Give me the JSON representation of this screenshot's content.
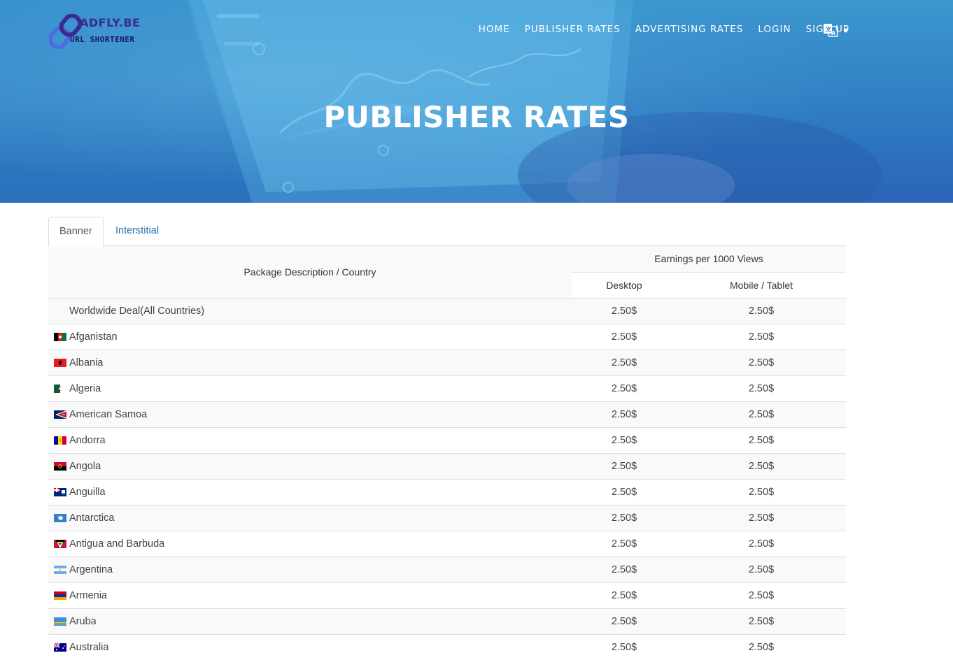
{
  "brand": {
    "name_top": "ADFLY.BE",
    "name_bottom": "URL SHORTENER",
    "mark_colors": [
      "#3b2a8f",
      "#4f6ce0"
    ]
  },
  "nav": {
    "items": [
      {
        "label": "HOME"
      },
      {
        "label": "PUBLISHER RATES"
      },
      {
        "label": "ADVERTISING RATES"
      },
      {
        "label": "LOGIN"
      },
      {
        "label": "SIGN UP"
      }
    ],
    "language_icon": "translate-icon"
  },
  "hero": {
    "title": "PUBLISHER RATES"
  },
  "tabs": [
    {
      "label": "Banner",
      "active": true
    },
    {
      "label": "Interstitial",
      "active": false
    }
  ],
  "table": {
    "header_package": "Package Description / Country",
    "header_earnings": "Earnings per 1000 Views",
    "header_desktop": "Desktop",
    "header_mobile": "Mobile / Tablet",
    "rows": [
      {
        "country": "Worldwide Deal(All Countries)",
        "desktop": "2.50$",
        "mobile": "2.50$",
        "flag": ""
      },
      {
        "country": "Afganistan",
        "desktop": "2.50$",
        "mobile": "2.50$",
        "flag": "af"
      },
      {
        "country": "Albania",
        "desktop": "2.50$",
        "mobile": "2.50$",
        "flag": "al"
      },
      {
        "country": "Algeria",
        "desktop": "2.50$",
        "mobile": "2.50$",
        "flag": "dz"
      },
      {
        "country": "American Samoa",
        "desktop": "2.50$",
        "mobile": "2.50$",
        "flag": "as"
      },
      {
        "country": "Andorra",
        "desktop": "2.50$",
        "mobile": "2.50$",
        "flag": "ad"
      },
      {
        "country": "Angola",
        "desktop": "2.50$",
        "mobile": "2.50$",
        "flag": "ao"
      },
      {
        "country": "Anguilla",
        "desktop": "2.50$",
        "mobile": "2.50$",
        "flag": "ai"
      },
      {
        "country": "Antarctica",
        "desktop": "2.50$",
        "mobile": "2.50$",
        "flag": "aq"
      },
      {
        "country": "Antigua and Barbuda",
        "desktop": "2.50$",
        "mobile": "2.50$",
        "flag": "ag"
      },
      {
        "country": "Argentina",
        "desktop": "2.50$",
        "mobile": "2.50$",
        "flag": "ar"
      },
      {
        "country": "Armenia",
        "desktop": "2.50$",
        "mobile": "2.50$",
        "flag": "am"
      },
      {
        "country": "Aruba",
        "desktop": "2.50$",
        "mobile": "2.50$",
        "flag": "aw"
      },
      {
        "country": "Australia",
        "desktop": "2.50$",
        "mobile": "2.50$",
        "flag": "au"
      }
    ]
  }
}
